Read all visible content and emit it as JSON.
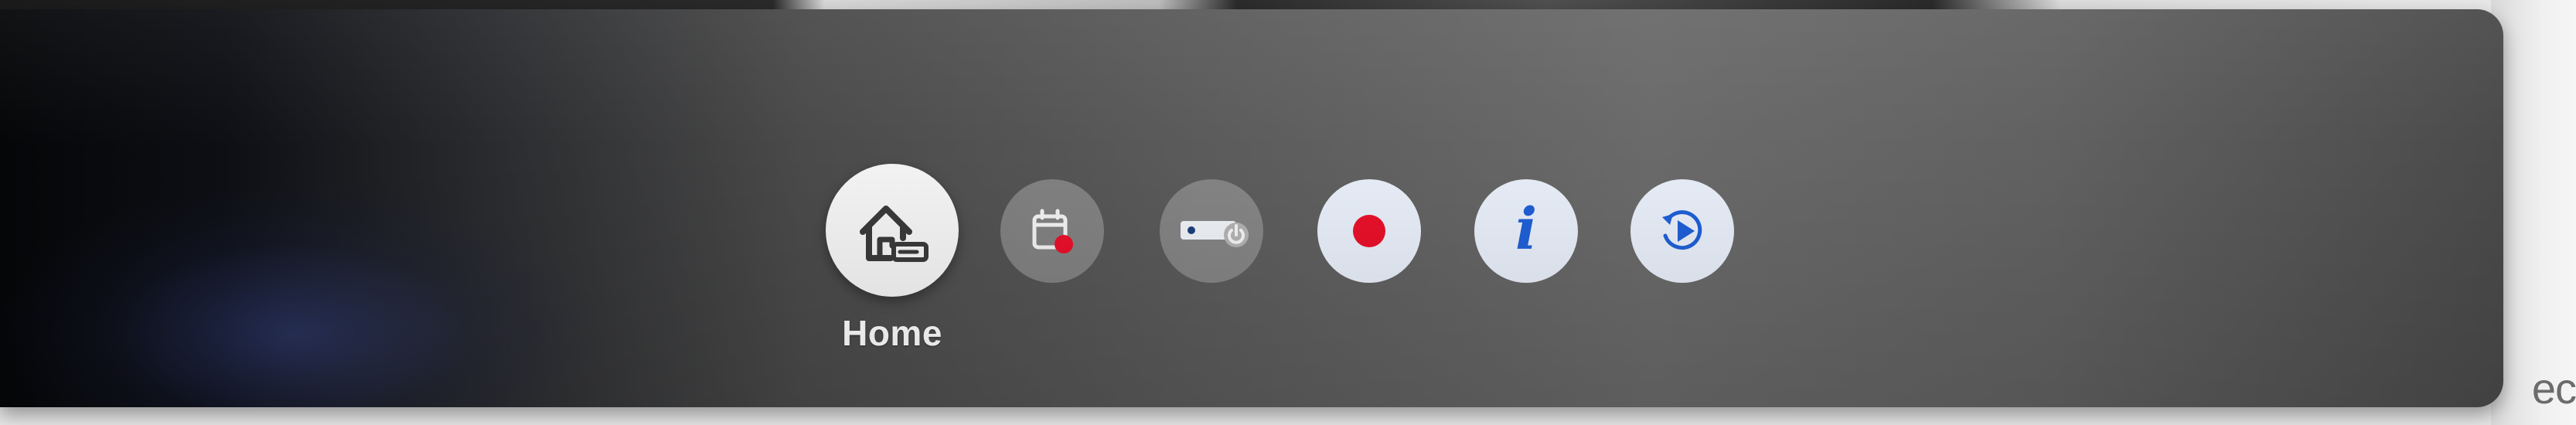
{
  "background": {
    "edge_text": "ec"
  },
  "toolbar": {
    "home": {
      "label": "Home",
      "icon": "home-input-icon"
    },
    "buttons": [
      {
        "icon": "schedule-icon",
        "state": "dimmed"
      },
      {
        "icon": "device-power-icon",
        "state": "dimmed"
      },
      {
        "icon": "record-icon",
        "state": "active"
      },
      {
        "icon": "info-icon",
        "glyph": "i",
        "state": "active"
      },
      {
        "icon": "replay-icon",
        "state": "active"
      }
    ]
  },
  "colors": {
    "record_red": "#e8102a",
    "info_blue": "#1f5fd6",
    "home_icon": "#3a3a3a"
  }
}
